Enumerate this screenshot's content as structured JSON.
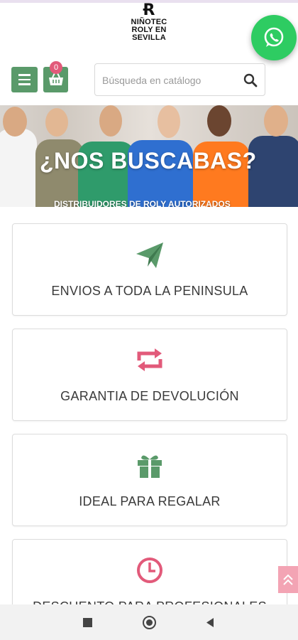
{
  "header": {
    "logo_lines": [
      "NIÑOTEC",
      "ROLY EN",
      "SEVILLA"
    ],
    "logo_mark": "Ɍ",
    "cart_count": "0",
    "search_placeholder": "Búsqueda en catálogo"
  },
  "banner": {
    "title": "¿NOS BUSCABAS?",
    "subtitle": "DISTRIBUIDORES DE ROLY AUTORIZADOS"
  },
  "features": [
    {
      "label": "ENVIOS A TODA LA PENINSULA",
      "icon": "paper-plane-icon",
      "color": "#5a9a6a"
    },
    {
      "label": "GARANTIA DE DEVOLUCIÓN",
      "icon": "retweet-icon",
      "color": "#e25a7a"
    },
    {
      "label": "IDEAL PARA REGALAR",
      "icon": "gift-icon",
      "color": "#5a9a6a"
    },
    {
      "label": "DESCUENTO PARA PROFESIONALES",
      "icon": "clock-icon",
      "color": "#e25a7a"
    }
  ],
  "colors": {
    "green": "#5a9a6a",
    "pink": "#e25a7a",
    "whatsapp": "#2ecc62"
  }
}
